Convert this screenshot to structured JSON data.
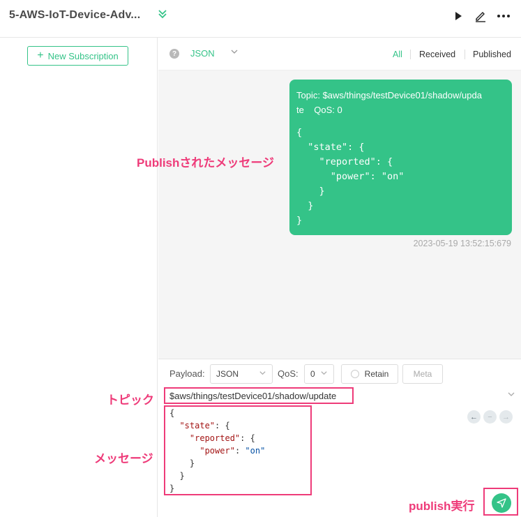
{
  "header": {
    "connection_name": "5-AWS-IoT-Device-Adv...",
    "icons": [
      "chevrons-down-icon",
      "play-icon",
      "edit-icon",
      "more-icon"
    ]
  },
  "sidebar": {
    "new_subscription_label": "New Subscription"
  },
  "filter_bar": {
    "help_symbol": "?",
    "format": "JSON",
    "tabs": [
      "All",
      "Received",
      "Published"
    ],
    "active_tab": "All"
  },
  "message": {
    "topic_line1": "Topic: $aws/things/testDevice01/shadow/upda",
    "topic_line2": "te    QoS: 0",
    "payload": "{\n  \"state\": {\n    \"reported\": {\n      \"power\": \"on\"\n    }\n  }\n}",
    "timestamp": "2023-05-19 13:52:15:679"
  },
  "publish": {
    "payload_label": "Payload:",
    "payload_format": "JSON",
    "qos_label": "QoS:",
    "qos_value": "0",
    "retain_label": "Retain",
    "meta_label": "Meta",
    "topic_value": "$aws/things/testDevice01/shadow/update"
  },
  "annotations": {
    "published_message": "Publishされたメッセージ",
    "topic": "トピック",
    "message": "メッセージ",
    "publish_exec": "publish実行"
  },
  "colors": {
    "accent": "#34c388",
    "annotation": "#ee3b79"
  }
}
